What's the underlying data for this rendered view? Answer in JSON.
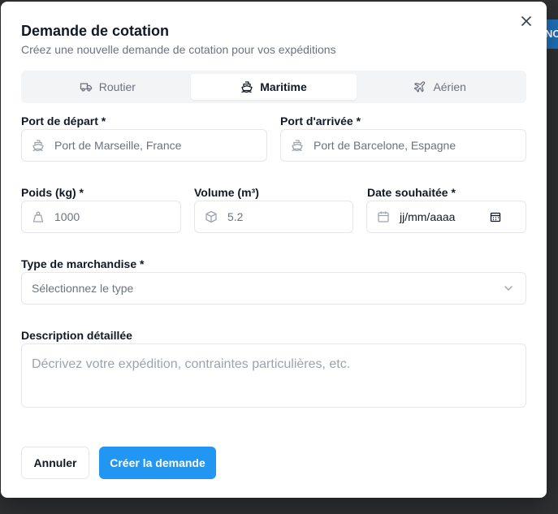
{
  "background": {
    "partial_button_text": "NC"
  },
  "dialog": {
    "title": "Demande de cotation",
    "subtitle": "Créez une nouvelle demande de cotation pour vos expéditions"
  },
  "tabs": [
    {
      "label": "Routier",
      "icon": "truck-icon",
      "active": false
    },
    {
      "label": "Maritime",
      "icon": "ship-icon",
      "active": true
    },
    {
      "label": "Aérien",
      "icon": "plane-icon",
      "active": false
    }
  ],
  "form": {
    "departure": {
      "label": "Port de départ *",
      "placeholder": "Port de Marseille, France"
    },
    "arrival": {
      "label": "Port d'arrivée *",
      "placeholder": "Port de Barcelone, Espagne"
    },
    "weight": {
      "label": "Poids (kg) *",
      "placeholder": "1000"
    },
    "volume": {
      "label": "Volume (m³)",
      "placeholder": "5.2"
    },
    "date": {
      "label": "Date souhaitée *",
      "placeholder": "jj/mm/aaaa"
    },
    "goods_type": {
      "label": "Type de marchandise *",
      "selected": "Sélectionnez le type"
    },
    "description": {
      "label": "Description détaillée",
      "placeholder": "Décrivez votre expédition, contraintes particulières, etc."
    }
  },
  "actions": {
    "cancel": "Annuler",
    "submit": "Créer la demande"
  },
  "colors": {
    "primary": "#2196f3",
    "muted": "#6b7280",
    "border": "#e5e7eb"
  }
}
